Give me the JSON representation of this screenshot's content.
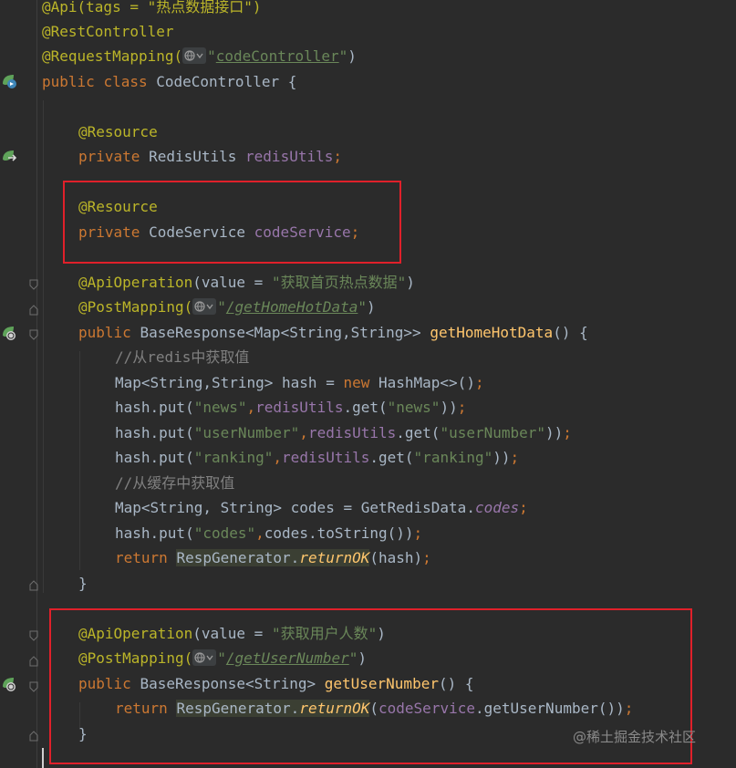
{
  "code": {
    "api_line": "@Api(tags = \"热点数据接口\")",
    "rest_controller": "@RestController",
    "request_mapping_ann": "@RequestMapping(",
    "request_mapping_url": "codeController",
    "class_public": "public ",
    "class_kw": "class ",
    "class_decl": "CodeController {",
    "resource_ann_1": "@Resource",
    "private_kw": "private ",
    "redis_type": "RedisUtils ",
    "redis_field": "redisUtils",
    "resource_ann_2": "@Resource",
    "code_service_type": "CodeService ",
    "code_service_field": "codeService",
    "api_op_1_ann": "@ApiOperation",
    "api_op_1_mid": "(value = ",
    "api_op_1_str": "\"获取首页热点数据\"",
    "post_mapping_ann": "@PostMapping(",
    "post_mapping_1_url": "/getHomeHotData",
    "public_kw": "public ",
    "method1_type": "BaseResponse<Map<String,String>> ",
    "method1_name": "getHomeHotData",
    "method1_end": "() {",
    "comment1": "//从redis中获取值",
    "map_decl": "Map<String,String> hash = ",
    "new_kw": "new ",
    "new_hashmap": "HashMap<>()",
    "put_prefix": "hash.put(",
    "key_news": "\"news\"",
    "key_usernumber": "\"userNumber\"",
    "key_ranking": "\"ranking\"",
    "redis_get": ".get(",
    "comment2": "//从缓存中获取值",
    "codes_decl": "Map<String, String> codes = GetRedisData.",
    "codes_field": "codes",
    "key_codes": "\"codes\"",
    "codes_tostring": "codes.toString()",
    "return_kw": "return ",
    "resp_gen": "RespGenerator",
    "return_ok": "returnOK",
    "hash_arg": "(hash)",
    "close_brace": "}",
    "api_op_2_str": "\"获取用户人数\"",
    "post_mapping_2_url": "/getUserNumber",
    "method2_type": "BaseResponse<String> ",
    "method2_name": "getUserNumber",
    "method2_call": "getUserNumber()",
    "paren_close": ")",
    "semicolon": ";",
    "comma": ","
  },
  "watermark": "@稀土掘金技术社区",
  "colors": {
    "background": "#2b2b2b",
    "keyword": "#cc7832",
    "annotation": "#bbb529",
    "string": "#6a8759",
    "field": "#9876aa",
    "method": "#ffc66d",
    "comment": "#808080",
    "highlight_box": "#e0202a"
  },
  "icons": [
    "spring-bean-icon",
    "web-endpoint-icon",
    "fold-marker-icon",
    "globe-icon"
  ]
}
